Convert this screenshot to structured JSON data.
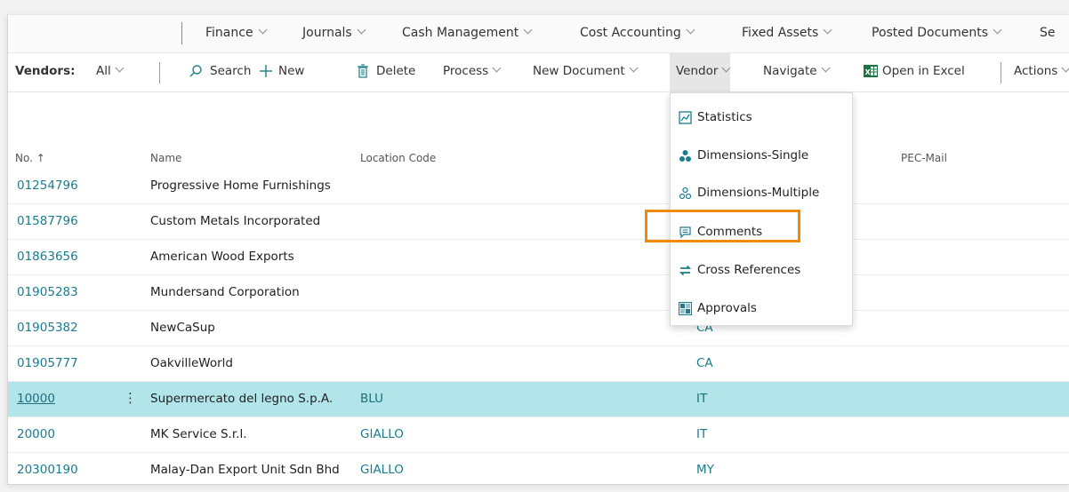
{
  "top_menu": {
    "items": [
      "Finance",
      "Journals",
      "Cash Management",
      "Cost Accounting",
      "Fixed Assets",
      "Posted Documents",
      "Se"
    ]
  },
  "action_bar": {
    "vendors_label": "Vendors:",
    "filter_value": "All",
    "search": "Search",
    "new": "New",
    "delete": "Delete",
    "process": "Process",
    "new_document": "New Document",
    "vendor": "Vendor",
    "navigate": "Navigate",
    "open_in_excel": "Open in Excel",
    "actions": "Actions"
  },
  "columns": {
    "no": "No. ↑",
    "name": "Name",
    "location_code": "Location Code",
    "pec_mail": "PEC-Mail"
  },
  "rows": [
    {
      "no": "01254796",
      "name": "Progressive Home Furnishings",
      "location": "",
      "country": ""
    },
    {
      "no": "01587796",
      "name": "Custom Metals Incorporated",
      "location": "",
      "country": ""
    },
    {
      "no": "01863656",
      "name": "American Wood Exports",
      "location": "",
      "country": ""
    },
    {
      "no": "01905283",
      "name": "Mundersand Corporation",
      "location": "",
      "country": ""
    },
    {
      "no": "01905382",
      "name": "NewCaSup",
      "location": "",
      "country": "CA"
    },
    {
      "no": "01905777",
      "name": "OakvilleWorld",
      "location": "",
      "country": "CA"
    },
    {
      "no": "10000",
      "name": "Supermercato del legno S.p.A.",
      "location": "BLU",
      "country": "IT"
    },
    {
      "no": "20000",
      "name": "MK Service S.r.l.",
      "location": "GIALLO",
      "country": "IT"
    },
    {
      "no": "20300190",
      "name": "Malay-Dan Export Unit Sdn Bhd",
      "location": "GIALLO",
      "country": "MY"
    }
  ],
  "vendor_menu": {
    "items": [
      "Statistics",
      "Dimensions-Single",
      "Dimensions-Multiple",
      "Comments",
      "Cross References",
      "Approvals"
    ],
    "highlighted": "Comments"
  },
  "colors": {
    "link": "#1a7d8e",
    "selected_row": "#b2e5ea",
    "highlight_box": "#f08a00",
    "excel_green": "#1e7145"
  }
}
